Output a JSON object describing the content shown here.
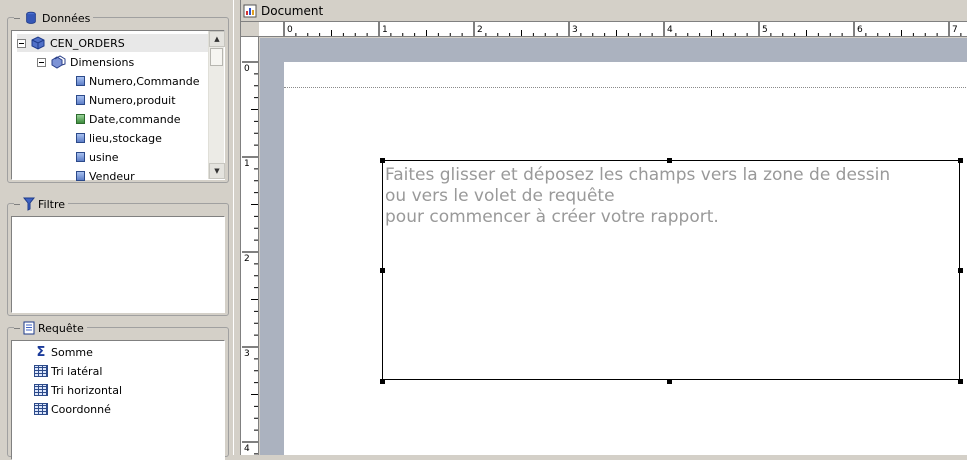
{
  "window": {
    "width": 967,
    "height": 455
  },
  "data_panel": {
    "title": "Données",
    "tree": {
      "root": "CEN_ORDERS",
      "folder": "Dimensions",
      "fields": [
        {
          "label": "Numero,Commande",
          "icon": "field-icon"
        },
        {
          "label": "Numero,produit",
          "icon": "field-icon"
        },
        {
          "label": "Date,commande",
          "icon": "date-field-icon"
        },
        {
          "label": "lieu,stockage",
          "icon": "field-icon"
        },
        {
          "label": "usine",
          "icon": "field-icon"
        },
        {
          "label": "Vendeur",
          "icon": "field-icon"
        }
      ]
    }
  },
  "filter_panel": {
    "title": "Filtre"
  },
  "query_panel": {
    "title": "Requête",
    "items": [
      {
        "label": "Somme",
        "icon": "sigma-icon"
      },
      {
        "label": "Tri latéral",
        "icon": "table-icon"
      },
      {
        "label": "Tri horizontal",
        "icon": "table-icon"
      },
      {
        "label": "Coordonné",
        "icon": "table-icon"
      }
    ]
  },
  "document": {
    "title": "Document",
    "ruler_h_labels": [
      "0",
      "1",
      "2",
      "3",
      "4",
      "5",
      "6",
      "7"
    ],
    "ruler_v_labels": [
      "0",
      "1",
      "2",
      "3",
      "4"
    ],
    "drop_hint_lines": [
      "Faites glisser et déposez les champs vers la zone de dessin",
      "ou vers le volet de requête",
      "pour commencer à créer votre rapport."
    ]
  },
  "colors": {
    "panel_bg": "#d4d0c8",
    "canvas_bg": "#abb2bf",
    "hint_text": "#999999",
    "accent_blue": "#1a3a9a"
  }
}
